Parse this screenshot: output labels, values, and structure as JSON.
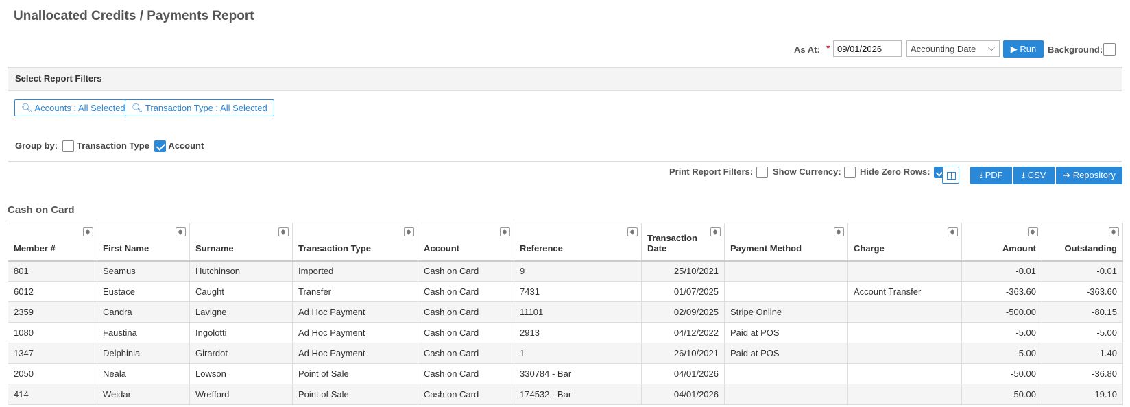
{
  "page": {
    "title": "Unallocated Credits / Payments Report"
  },
  "controls": {
    "as_at_label": "As At:",
    "required_mark": "*",
    "as_at_value": "09/01/2026",
    "date_type": "Accounting Date",
    "run_label": "Run",
    "background_label": "Background:",
    "background_checked": false
  },
  "filters": {
    "heading": "Select Report Filters",
    "accounts_label": "Accounts : All Selected",
    "transaction_type_label": "Transaction Type : All Selected",
    "group_by_label": "Group by:",
    "group_by_options": [
      {
        "label": "Transaction Type",
        "checked": false
      },
      {
        "label": "Account",
        "checked": true
      }
    ]
  },
  "export": {
    "print_report_filters_label": "Print Report Filters:",
    "print_report_filters_checked": false,
    "show_currency_label": "Show Currency:",
    "show_currency_checked": false,
    "hide_zero_rows_label": "Hide Zero Rows:",
    "hide_zero_rows_checked": true,
    "pdf_label": "PDF",
    "csv_label": "CSV",
    "repository_label": "Repository"
  },
  "section": {
    "title": "Cash on Card"
  },
  "table": {
    "columns": [
      "Member #",
      "First Name",
      "Surname",
      "Transaction Type",
      "Account",
      "Reference",
      "Transaction Date",
      "Payment Method",
      "Charge",
      "Amount",
      "Outstanding"
    ],
    "rows": [
      [
        "801",
        "Seamus",
        "Hutchinson",
        "Imported",
        "Cash on Card",
        "9",
        "25/10/2021",
        "",
        "",
        "-0.01",
        "-0.01"
      ],
      [
        "6012",
        "Eustace",
        "Caught",
        "Transfer",
        "Cash on Card",
        "7431",
        "01/07/2025",
        "",
        "Account Transfer",
        "-363.60",
        "-363.60"
      ],
      [
        "2359",
        "Candra",
        "Lavigne",
        "Ad Hoc Payment",
        "Cash on Card",
        "11101",
        "02/09/2025",
        "Stripe Online",
        "",
        "-500.00",
        "-80.15"
      ],
      [
        "1080",
        "Faustina",
        "Ingolotti",
        "Ad Hoc Payment",
        "Cash on Card",
        "2913",
        "04/12/2022",
        "Paid at POS",
        "",
        "-5.00",
        "-5.00"
      ],
      [
        "1347",
        "Delphinia",
        "Girardot",
        "Ad Hoc Payment",
        "Cash on Card",
        "1",
        "26/10/2021",
        "Paid at POS",
        "",
        "-5.00",
        "-1.40"
      ],
      [
        "2050",
        "Neala",
        "Lowson",
        "Point of Sale",
        "Cash on Card",
        "330784 - Bar",
        "04/01/2026",
        "",
        "",
        "-50.00",
        "-36.80"
      ],
      [
        "414",
        "Weidar",
        "Wrefford",
        "Point of Sale",
        "Cash on Card",
        "174532 - Bar",
        "04/01/2026",
        "",
        "",
        "-50.00",
        "-19.10"
      ]
    ]
  },
  "colors": {
    "accent": "#2a88d8",
    "required": "#cc0000"
  }
}
